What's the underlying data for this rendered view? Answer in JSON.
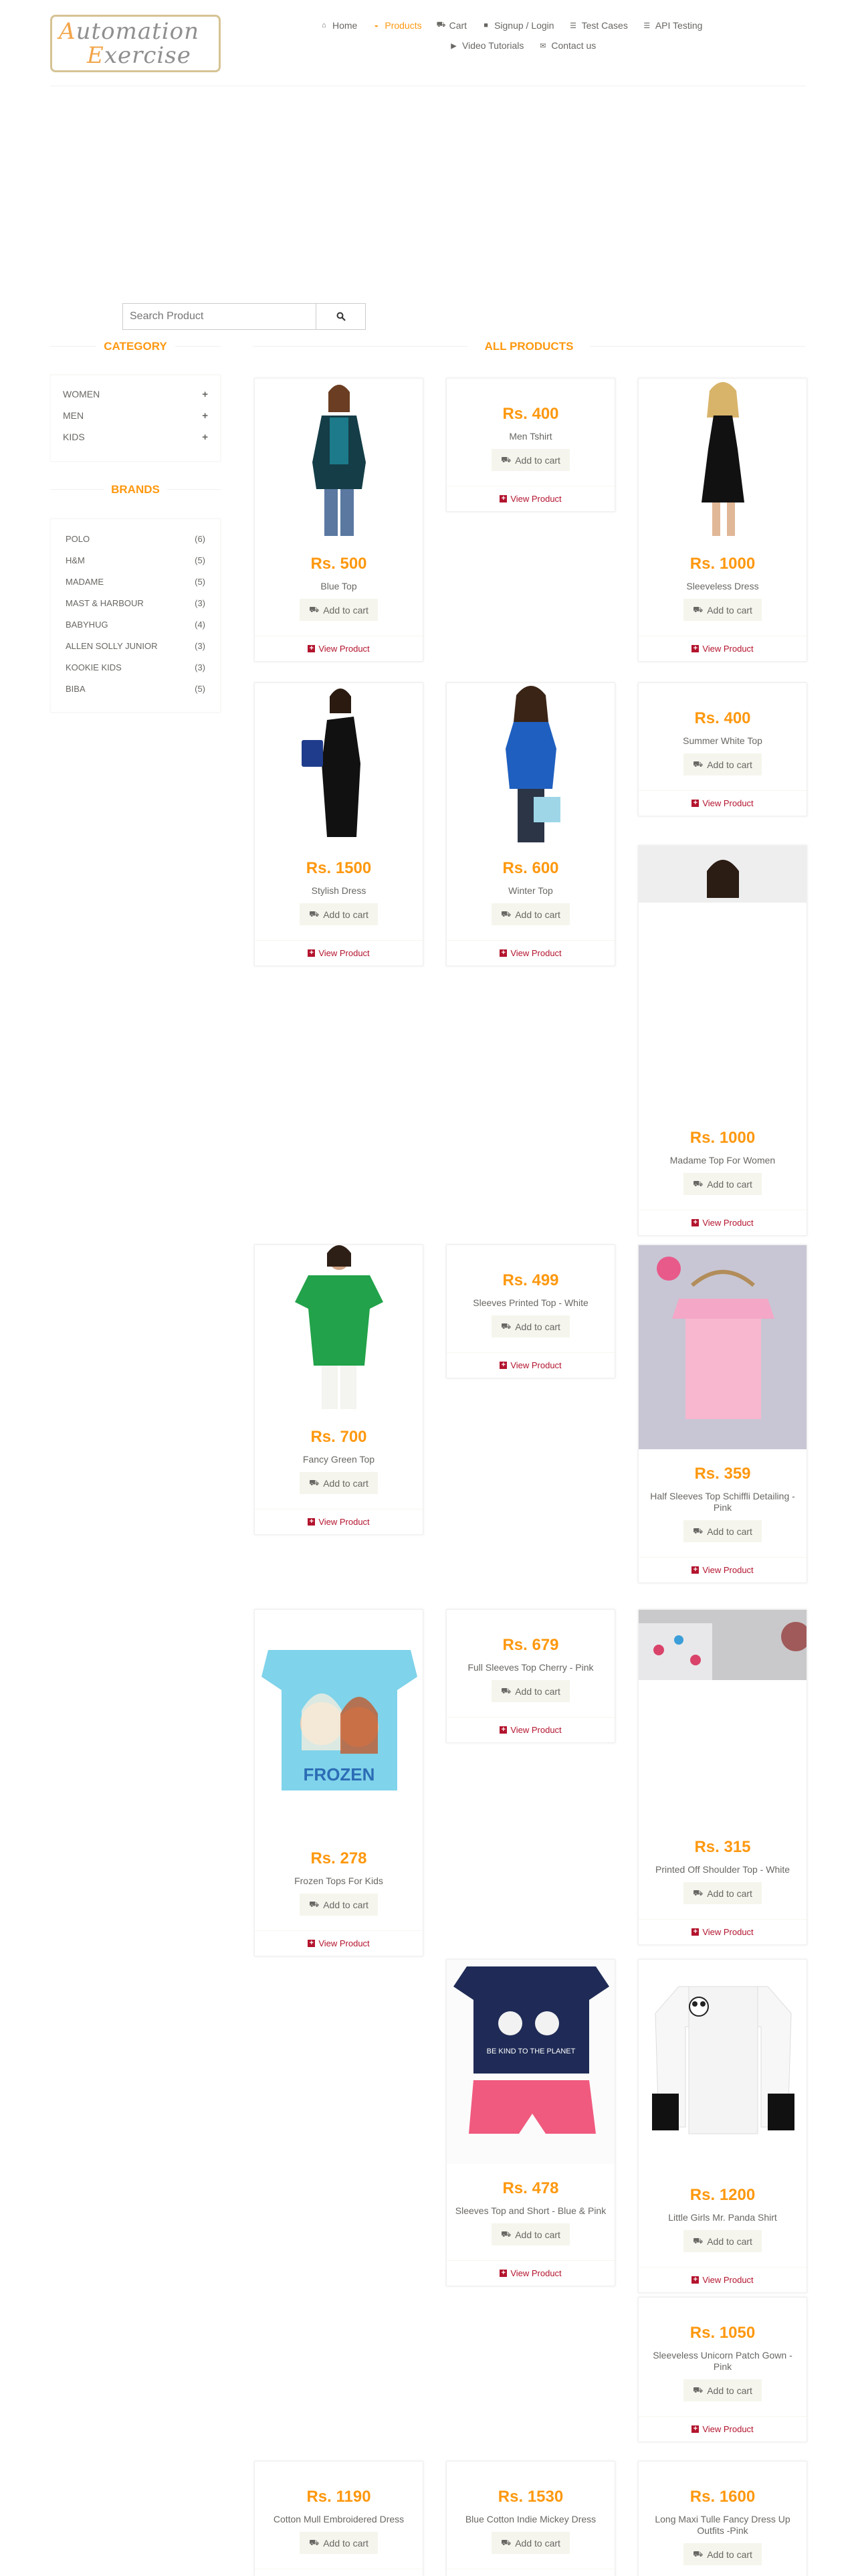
{
  "brand": {
    "logo_line1": "Automation",
    "logo_line2": "Exercise"
  },
  "nav": [
    {
      "label": "Home",
      "icon": "home-icon",
      "active": false
    },
    {
      "label": "Products",
      "icon": "tshirt-icon",
      "active": true
    },
    {
      "label": "Cart",
      "icon": "cart-icon",
      "active": false
    },
    {
      "label": "Signup / Login",
      "icon": "lock-icon",
      "active": false
    },
    {
      "label": "Test Cases",
      "icon": "list-icon",
      "active": false
    },
    {
      "label": "API Testing",
      "icon": "list-icon",
      "active": false
    },
    {
      "label": "Video Tutorials",
      "icon": "youtube-icon",
      "active": false
    },
    {
      "label": "Contact us",
      "icon": "envelope-icon",
      "active": false
    }
  ],
  "search": {
    "placeholder": "Search Product",
    "button_icon": "search-icon"
  },
  "category": {
    "title": "Category",
    "items": [
      {
        "label": "Women"
      },
      {
        "label": "Men"
      },
      {
        "label": "Kids"
      }
    ]
  },
  "brands": {
    "title": "Brands",
    "items": [
      {
        "label": "Polo",
        "count": "(6)"
      },
      {
        "label": "H&M",
        "count": "(5)"
      },
      {
        "label": "Madame",
        "count": "(5)"
      },
      {
        "label": "Mast & Harbour",
        "count": "(3)"
      },
      {
        "label": "Babyhug",
        "count": "(4)"
      },
      {
        "label": "Allen Solly Junior",
        "count": "(3)"
      },
      {
        "label": "Kookie Kids",
        "count": "(3)"
      },
      {
        "label": "Biba",
        "count": "(5)"
      }
    ]
  },
  "products_title": "All Products",
  "add_to_cart_label": "Add to cart",
  "view_product_label": "View Product",
  "products": [
    {
      "price": "Rs. 500",
      "name": "Blue Top"
    },
    {
      "price": "Rs. 400",
      "name": "Men Tshirt"
    },
    {
      "price": "Rs. 1000",
      "name": "Sleeveless Dress"
    },
    {
      "price": "Rs. 1500",
      "name": "Stylish Dress"
    },
    {
      "price": "Rs. 600",
      "name": "Winter Top"
    },
    {
      "price": "Rs. 400",
      "name": "Summer White Top"
    },
    {
      "price": "Rs. 1000",
      "name": "Madame Top For Women"
    },
    {
      "price": "Rs. 700",
      "name": "Fancy Green Top"
    },
    {
      "price": "Rs. 499",
      "name": "Sleeves Printed Top - White"
    },
    {
      "price": "Rs. 359",
      "name": "Half Sleeves Top Schiffli Detailing - Pink"
    },
    {
      "price": "Rs. 278",
      "name": "Frozen Tops For Kids"
    },
    {
      "price": "Rs. 679",
      "name": "Full Sleeves Top Cherry - Pink"
    },
    {
      "price": "Rs. 315",
      "name": "Printed Off Shoulder Top - White"
    },
    {
      "price": "Rs. 478",
      "name": "Sleeves Top and Short - Blue & Pink"
    },
    {
      "price": "Rs. 1200",
      "name": "Little Girls Mr. Panda Shirt"
    },
    {
      "price": "Rs. 1050",
      "name": "Sleeveless Unicorn Patch Gown - Pink"
    },
    {
      "price": "Rs. 1190",
      "name": "Cotton Mull Embroidered Dress"
    },
    {
      "price": "Rs. 1530",
      "name": "Blue Cotton Indie Mickey Dress"
    },
    {
      "price": "Rs. 1600",
      "name": "Long Maxi Tulle Fancy Dress Up Outfits -Pink"
    }
  ]
}
